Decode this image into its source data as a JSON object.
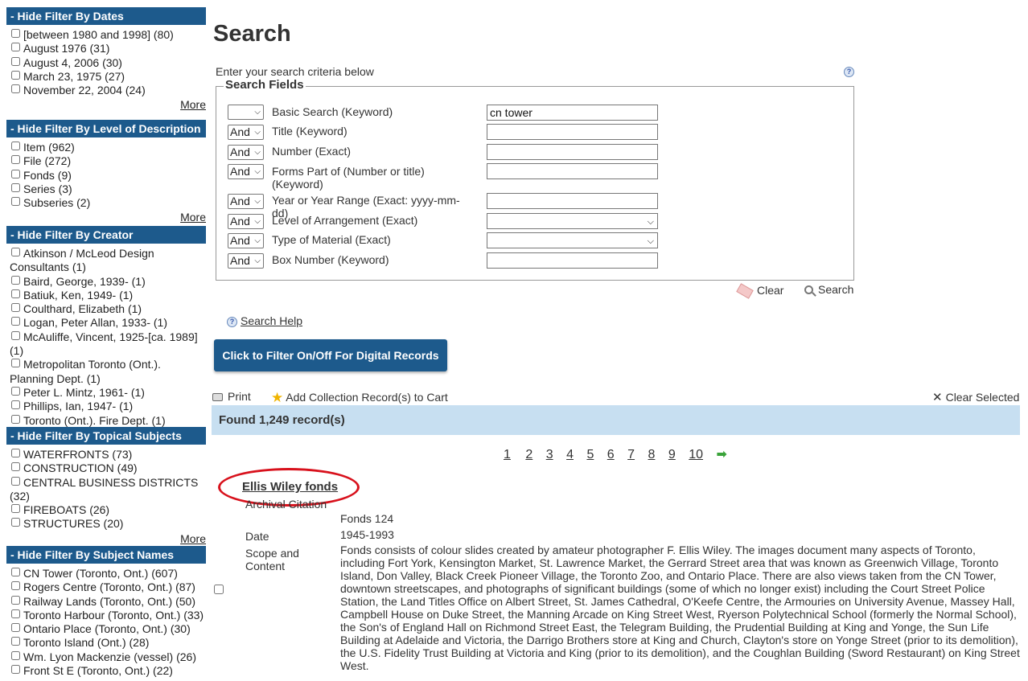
{
  "sidebar": {
    "facets": [
      {
        "id": "dates",
        "title": "- Hide Filter By Dates",
        "items": [
          "[between 1980 and 1998] (80)",
          "August 1976 (31)",
          "August 4, 2006 (30)",
          "March 23, 1975 (27)",
          "November 22, 2004 (24)"
        ],
        "more": "More"
      },
      {
        "id": "level",
        "title": "- Hide Filter By Level of Description",
        "items": [
          "Item (962)",
          "File (272)",
          "Fonds (9)",
          "Series (3)",
          "Subseries (2)"
        ],
        "more": "More"
      },
      {
        "id": "creator",
        "title": "- Hide Filter By Creator",
        "items": [
          "Atkinson / McLeod Design Consultants (1)",
          "Baird, George, 1939- (1)",
          "Batiuk, Ken, 1949- (1)",
          "Coulthard, Elizabeth (1)",
          "Logan, Peter Allan, 1933- (1)",
          "McAuliffe, Vincent, 1925-[ca. 1989] (1)",
          "Metropolitan Toronto (Ont.). Planning Dept. (1)",
          "Peter L. Mintz, 1961- (1)",
          "Phillips, Ian, 1947- (1)",
          "Toronto (Ont.). Fire Dept. (1)"
        ],
        "more": ""
      },
      {
        "id": "topical",
        "title": "- Hide Filter By Topical Subjects",
        "items": [
          "WATERFRONTS (73)",
          "CONSTRUCTION (49)",
          "CENTRAL BUSINESS DISTRICTS (32)",
          "FIREBOATS (26)",
          "STRUCTURES (20)"
        ],
        "more": "More"
      },
      {
        "id": "names",
        "title": "- Hide Filter By Subject Names",
        "items": [
          "CN Tower (Toronto, Ont.) (607)",
          "Rogers Centre (Toronto, Ont.) (87)",
          "Railway Lands (Toronto, Ont.) (50)",
          "Toronto Harbour (Toronto, Ont.) (33)",
          "Ontario Place (Toronto, Ont.) (30)",
          "Toronto Island (Ont.) (28)",
          "Wm. Lyon Mackenzie (vessel) (26)",
          "Front St E (Toronto, Ont.) (22)"
        ],
        "more": ""
      }
    ]
  },
  "main": {
    "title": "Search",
    "criteria_text": "Enter your search criteria below",
    "help_icon": "?",
    "legend": "Search Fields",
    "fields": [
      {
        "op": "",
        "label": "Basic Search  (Keyword)",
        "value": "cn tower",
        "type": "text"
      },
      {
        "op": "And",
        "label": "Title  (Keyword)",
        "value": "",
        "type": "text"
      },
      {
        "op": "And",
        "label": "Number  (Exact)",
        "value": "",
        "type": "text"
      },
      {
        "op": "And",
        "label": "Forms Part of (Number or title) (Keyword)",
        "value": "",
        "type": "text"
      },
      {
        "op": "And",
        "label": "Year or Year Range  (Exact: yyyy-mm-dd)",
        "value": "",
        "type": "text"
      },
      {
        "op": "And",
        "label": "Level of Arrangement  (Exact)",
        "value": "",
        "type": "select"
      },
      {
        "op": "And",
        "label": "Type of Material  (Exact)",
        "value": "",
        "type": "select"
      },
      {
        "op": "And",
        "label": "Box Number  (Keyword)",
        "value": "",
        "type": "text"
      }
    ],
    "clear_label": "Clear",
    "search_label": "Search",
    "search_help": "Search Help",
    "digital_button": "Click to Filter On/Off For Digital Records",
    "print_label": "Print",
    "cart_label": "Add Collection Record(s) to Cart",
    "clear_selected_label": "Clear Selected",
    "found_text": "Found 1,249 record(s)",
    "pages": [
      "1",
      "2",
      "3",
      "4",
      "5",
      "6",
      "7",
      "8",
      "9",
      "10"
    ],
    "next_arrow": "➡",
    "result": {
      "title": "Ellis Wiley fonds",
      "citation_label": "Archival Citation",
      "citation_value": "Fonds 124",
      "date_label": "Date",
      "date_value": "1945-1993",
      "scope_label": "Scope and Content",
      "scope_value": "Fonds consists of colour slides created by amateur photographer F. Ellis Wiley. The images document many aspects of Toronto, including Fort York, Kensington Market, St. Lawrence Market, the Gerrard Street area that was known as Greenwich Village, Toronto Island, Don Valley, Black Creek Pioneer Village, the Toronto Zoo, and Ontario Place. There are also views taken from the CN Tower, downtown streetscapes, and photographs of significant buildings (some of which no longer exist) including the Court Street Police Station, the Land Titles Office on Albert Street, St. James Cathedral, O'Keefe Centre, the Armouries on University Avenue, Massey Hall, Campbell House on Duke Street, the Manning Arcade on King Street West, Ryerson Polytechnical School (formerly the Normal School), the Son's of England Hall on Richmond Street East, the Telegram Building, the Prudential Building at King and Yonge, the Sun Life Building at Adelaide and Victoria, the Darrigo Brothers store at King and Church, Clayton's store on Yonge Street (prior to its demolition), the U.S. Fidelity Trust Building at Victoria and King (prior to its demolition), and the Coughlan Building (Sword Restaurant) on King Street West."
    },
    "colors": {
      "header_blue": "#1d5a8c",
      "found_bar": "#c7dff1",
      "highlight_circle": "#d8111c"
    }
  }
}
